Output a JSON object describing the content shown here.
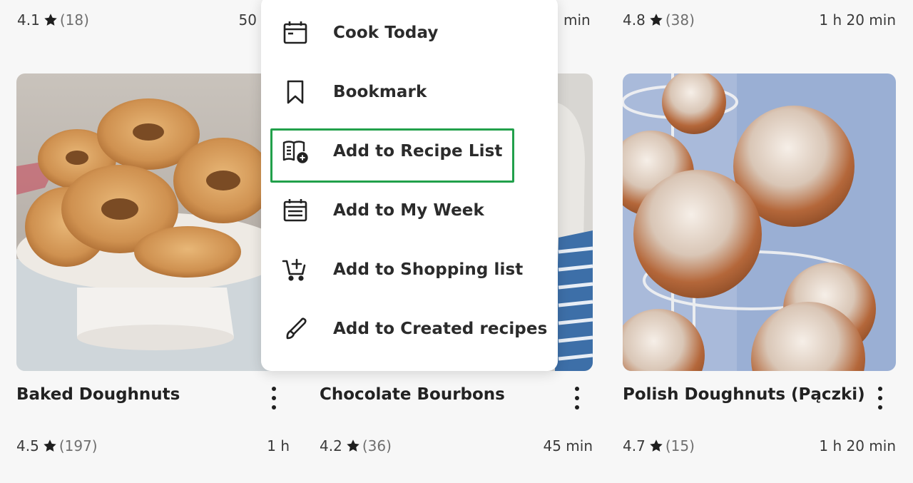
{
  "top_row": [
    {
      "rating": "4.1",
      "count": "(18)",
      "time": "50"
    },
    {
      "rating": "",
      "count": "",
      "time": "min"
    },
    {
      "rating": "4.8",
      "count": "(38)",
      "time": "1 h 20 min"
    }
  ],
  "cards": [
    {
      "title": "Baked Doughnuts",
      "rating": "4.5",
      "count": "(197)",
      "time": "1 h"
    },
    {
      "title": "Chocolate Bourbons",
      "rating": "4.2",
      "count": "(36)",
      "time": "45 min"
    },
    {
      "title": "Polish Doughnuts (Pączki)",
      "rating": "4.7",
      "count": "(15)",
      "time": "1 h 20 min"
    }
  ],
  "menu": {
    "items": [
      {
        "label": "Cook Today",
        "icon": "calendar-icon"
      },
      {
        "label": "Bookmark",
        "icon": "bookmark-icon"
      },
      {
        "label": "Add to Recipe List",
        "icon": "recipe-book-add-icon"
      },
      {
        "label": "Add to My Week",
        "icon": "calendar-week-icon"
      },
      {
        "label": "Add to Shopping list",
        "icon": "cart-add-icon"
      },
      {
        "label": "Add to Created recipes",
        "icon": "pen-icon"
      }
    ],
    "highlighted": "Add to Recipe List"
  },
  "colors": {
    "highlight_border": "#22a04b",
    "star": "#1f1f1f",
    "background": "#f7f7f7"
  }
}
